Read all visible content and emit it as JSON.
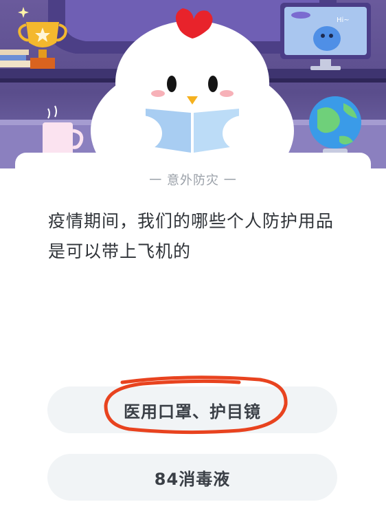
{
  "quiz": {
    "category": "一 意外防灾 一",
    "question": "疫情期间，我们的哪些个人防护用品是可以带上飞机的",
    "options": [
      {
        "label": "医用口罩、护目镜",
        "highlighted": true
      },
      {
        "label": "84消毒液",
        "highlighted": false
      }
    ]
  },
  "illustration": {
    "monitor_text": "Hi~",
    "icons": [
      "trophy-icon",
      "chick-mascot",
      "globe-icon",
      "cup-icon",
      "alien-icon"
    ]
  },
  "colors": {
    "hero_background": "#5f5296",
    "option_background": "#f1f4f6",
    "highlight_mark": "#e8431f"
  }
}
